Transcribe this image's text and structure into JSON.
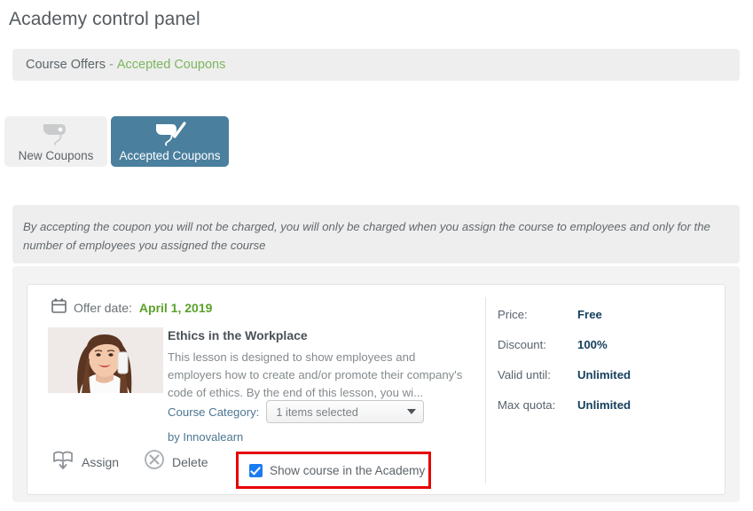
{
  "page": {
    "title": "Academy control panel"
  },
  "breadcrumb": {
    "main": "Course Offers",
    "separator": "-",
    "current": "Accepted Coupons"
  },
  "tabs": [
    {
      "label": "New Coupons",
      "icon": "coupon-tag-icon",
      "active": false
    },
    {
      "label": "Accepted Coupons",
      "icon": "coupon-tag-check-icon",
      "active": true
    }
  ],
  "notice": {
    "text": "By accepting the coupon you will not be charged, you will only be charged when you assign the course to employees and only for the number of employees you assigned the course"
  },
  "coupon": {
    "offer_date_label": "Offer date:",
    "offer_date_value": "April 1, 2019",
    "calendar_icon": "calendar-icon",
    "thumbnail_alt": "smiling-woman-on-phone-photo",
    "course_title": "Ethics in the Workplace",
    "course_description": "This lesson is designed to show employees and employers how to create and/or promote their company's code of ethics. By the end of this lesson, you wi...",
    "category_label": "Course Category:",
    "category_value": "1 items selected",
    "provider": "by Innovalearn",
    "assign_label": "Assign",
    "assign_icon": "book-download-icon",
    "delete_label": "Delete",
    "delete_icon": "circle-x-icon",
    "show_in_academy_label": "Show course in the Academy",
    "show_in_academy_checked": true,
    "details": [
      {
        "key": "Price:",
        "value": "Free"
      },
      {
        "key": "Discount:",
        "value": "100%"
      },
      {
        "key": "Valid until:",
        "value": "Unlimited"
      },
      {
        "key": "Max quota:",
        "value": "Unlimited"
      }
    ]
  },
  "colors": {
    "accent_teal": "#4a7f9e",
    "accent_green": "#7cb75d",
    "date_green": "#5aa12b",
    "detail_navy": "#16405e",
    "link_blue": "#4d7693",
    "highlight_red": "#e60000",
    "checkbox_blue": "#1a7cf0"
  }
}
